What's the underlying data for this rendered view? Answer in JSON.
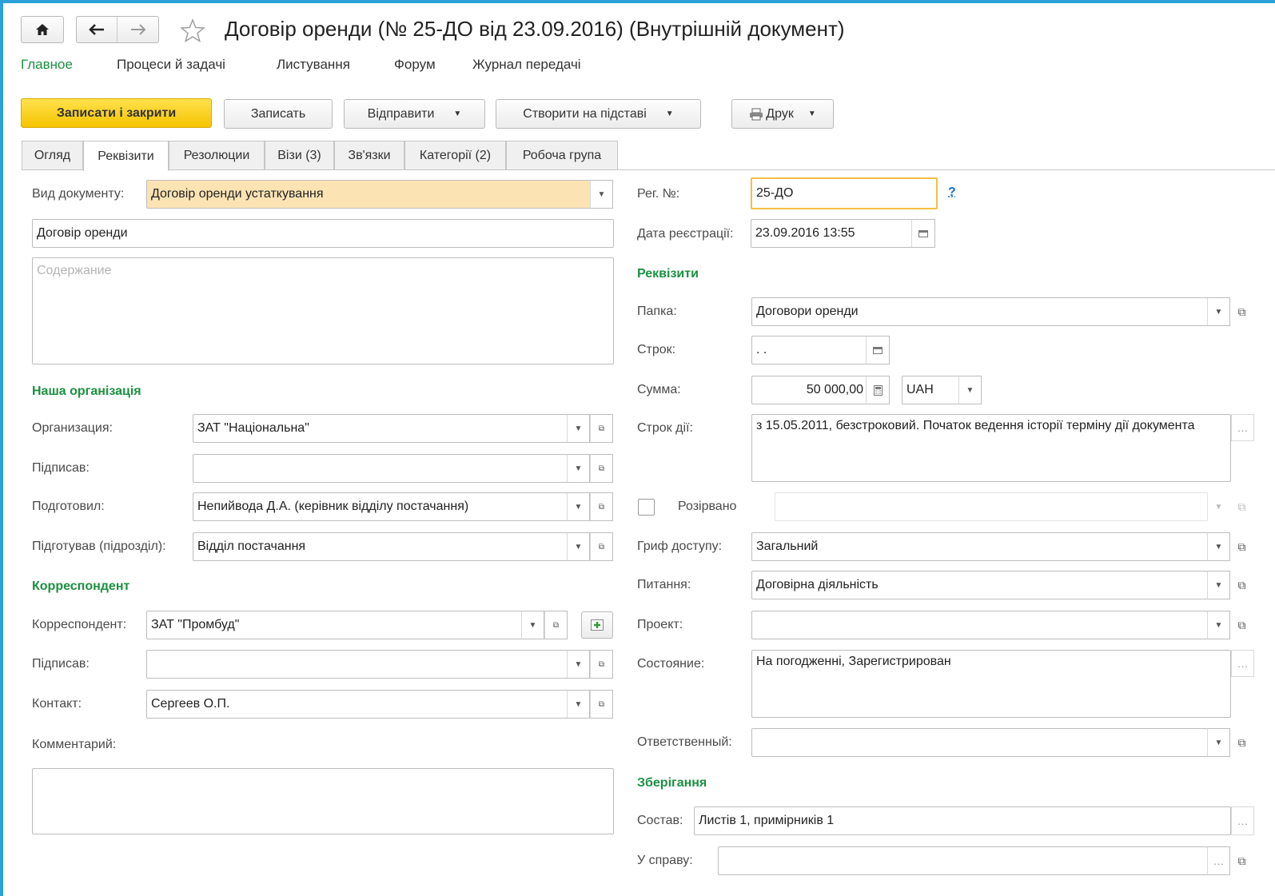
{
  "window": {
    "title": "Договір оренди (№ 25-ДО від 23.09.2016) (Внутрішній документ)"
  },
  "colors": {
    "accent": "#2aa2d9",
    "primary_button": "#f5c800",
    "section": "#1b9140",
    "highlight_field": "#fbe3b4"
  },
  "menu": {
    "items": [
      "Главное",
      "Процеси й задачі",
      "Листування",
      "Форум",
      "Журнал передачі"
    ]
  },
  "toolbar": {
    "save_close": "Записати і закрити",
    "save": "Записать",
    "send": "Відправити",
    "create_based": "Створити на підставі",
    "print": "Друк"
  },
  "tabs": [
    "Огляд",
    "Реквізити",
    "Резолюции",
    "Візи (3)",
    "Зв'язки",
    "Категорії (2)",
    "Робоча група"
  ],
  "left": {
    "doc_type_label": "Вид документу:",
    "doc_type_value": "Договір оренди устаткування",
    "title_value": "Договір оренди",
    "content_placeholder": "Содержание",
    "our_org_section": "Наша організація",
    "org_label": "Организация:",
    "org_value": "ЗАТ \"Національна\"",
    "signed_label": "Підписав:",
    "signed_value": "",
    "prepared_label": "Подготовил:",
    "prepared_value": "Непийвода Д.А. (керівник відділу постачання)",
    "prepared_dept_label": "Підготував (підрозділ):",
    "prepared_dept_value": "Відділ постачання",
    "correspondent_section": "Корреспондент",
    "correspondent_label": "Корреспондент:",
    "correspondent_value": "ЗАТ \"Промбуд\"",
    "corr_signed_label": "Підписав:",
    "corr_signed_value": "",
    "contact_label": "Контакт:",
    "contact_value": "Сергеев О.П.",
    "comment_label": "Комментарий:"
  },
  "right": {
    "reg_no_label": "Рег. №:",
    "reg_no_value": "25-ДО",
    "help": "?",
    "reg_date_label": "Дата реєстрації:",
    "reg_date_value": "23.09.2016 13:55",
    "requisites_section": "Реквізити",
    "folder_label": "Папка:",
    "folder_value": "Договори оренди",
    "term_label": "Строк:",
    "term_value": ". .",
    "sum_label": "Сумма:",
    "sum_value": "50 000,00",
    "currency_value": "UAH",
    "validity_label": "Строк дії:",
    "validity_value": "з 15.05.2011, безстроковий. Початок ведення історії терміну дії документа",
    "terminated_label": "Розірвано",
    "access_label": "Гриф доступу:",
    "access_value": "Загальний",
    "question_label": "Питання:",
    "question_value": "Договірна діяльність",
    "project_label": "Проект:",
    "project_value": "",
    "state_label": "Состояние:",
    "state_value": "На погодженні, Зарегистрирован",
    "responsible_label": "Ответственный:",
    "responsible_value": "",
    "storage_section": "Зберігання",
    "composition_label": "Состав:",
    "composition_value": "Листів 1, примірників 1",
    "case_label": "У справу:",
    "case_value": ""
  }
}
